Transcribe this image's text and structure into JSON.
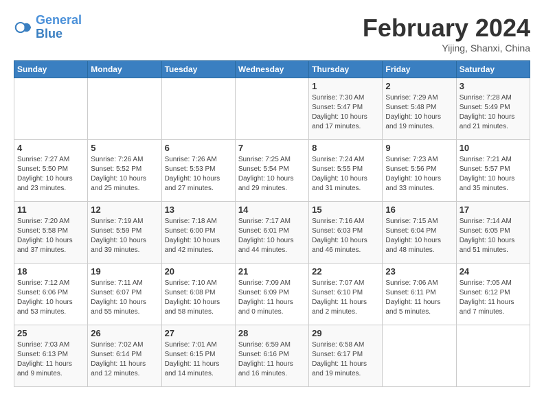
{
  "header": {
    "logo_line1": "General",
    "logo_line2": "Blue",
    "month_title": "February 2024",
    "location": "Yijing, Shanxi, China"
  },
  "weekdays": [
    "Sunday",
    "Monday",
    "Tuesday",
    "Wednesday",
    "Thursday",
    "Friday",
    "Saturday"
  ],
  "weeks": [
    [
      {
        "day": "",
        "info": ""
      },
      {
        "day": "",
        "info": ""
      },
      {
        "day": "",
        "info": ""
      },
      {
        "day": "",
        "info": ""
      },
      {
        "day": "1",
        "info": "Sunrise: 7:30 AM\nSunset: 5:47 PM\nDaylight: 10 hours\nand 17 minutes."
      },
      {
        "day": "2",
        "info": "Sunrise: 7:29 AM\nSunset: 5:48 PM\nDaylight: 10 hours\nand 19 minutes."
      },
      {
        "day": "3",
        "info": "Sunrise: 7:28 AM\nSunset: 5:49 PM\nDaylight: 10 hours\nand 21 minutes."
      }
    ],
    [
      {
        "day": "4",
        "info": "Sunrise: 7:27 AM\nSunset: 5:50 PM\nDaylight: 10 hours\nand 23 minutes."
      },
      {
        "day": "5",
        "info": "Sunrise: 7:26 AM\nSunset: 5:52 PM\nDaylight: 10 hours\nand 25 minutes."
      },
      {
        "day": "6",
        "info": "Sunrise: 7:26 AM\nSunset: 5:53 PM\nDaylight: 10 hours\nand 27 minutes."
      },
      {
        "day": "7",
        "info": "Sunrise: 7:25 AM\nSunset: 5:54 PM\nDaylight: 10 hours\nand 29 minutes."
      },
      {
        "day": "8",
        "info": "Sunrise: 7:24 AM\nSunset: 5:55 PM\nDaylight: 10 hours\nand 31 minutes."
      },
      {
        "day": "9",
        "info": "Sunrise: 7:23 AM\nSunset: 5:56 PM\nDaylight: 10 hours\nand 33 minutes."
      },
      {
        "day": "10",
        "info": "Sunrise: 7:21 AM\nSunset: 5:57 PM\nDaylight: 10 hours\nand 35 minutes."
      }
    ],
    [
      {
        "day": "11",
        "info": "Sunrise: 7:20 AM\nSunset: 5:58 PM\nDaylight: 10 hours\nand 37 minutes."
      },
      {
        "day": "12",
        "info": "Sunrise: 7:19 AM\nSunset: 5:59 PM\nDaylight: 10 hours\nand 39 minutes."
      },
      {
        "day": "13",
        "info": "Sunrise: 7:18 AM\nSunset: 6:00 PM\nDaylight: 10 hours\nand 42 minutes."
      },
      {
        "day": "14",
        "info": "Sunrise: 7:17 AM\nSunset: 6:01 PM\nDaylight: 10 hours\nand 44 minutes."
      },
      {
        "day": "15",
        "info": "Sunrise: 7:16 AM\nSunset: 6:03 PM\nDaylight: 10 hours\nand 46 minutes."
      },
      {
        "day": "16",
        "info": "Sunrise: 7:15 AM\nSunset: 6:04 PM\nDaylight: 10 hours\nand 48 minutes."
      },
      {
        "day": "17",
        "info": "Sunrise: 7:14 AM\nSunset: 6:05 PM\nDaylight: 10 hours\nand 51 minutes."
      }
    ],
    [
      {
        "day": "18",
        "info": "Sunrise: 7:12 AM\nSunset: 6:06 PM\nDaylight: 10 hours\nand 53 minutes."
      },
      {
        "day": "19",
        "info": "Sunrise: 7:11 AM\nSunset: 6:07 PM\nDaylight: 10 hours\nand 55 minutes."
      },
      {
        "day": "20",
        "info": "Sunrise: 7:10 AM\nSunset: 6:08 PM\nDaylight: 10 hours\nand 58 minutes."
      },
      {
        "day": "21",
        "info": "Sunrise: 7:09 AM\nSunset: 6:09 PM\nDaylight: 11 hours\nand 0 minutes."
      },
      {
        "day": "22",
        "info": "Sunrise: 7:07 AM\nSunset: 6:10 PM\nDaylight: 11 hours\nand 2 minutes."
      },
      {
        "day": "23",
        "info": "Sunrise: 7:06 AM\nSunset: 6:11 PM\nDaylight: 11 hours\nand 5 minutes."
      },
      {
        "day": "24",
        "info": "Sunrise: 7:05 AM\nSunset: 6:12 PM\nDaylight: 11 hours\nand 7 minutes."
      }
    ],
    [
      {
        "day": "25",
        "info": "Sunrise: 7:03 AM\nSunset: 6:13 PM\nDaylight: 11 hours\nand 9 minutes."
      },
      {
        "day": "26",
        "info": "Sunrise: 7:02 AM\nSunset: 6:14 PM\nDaylight: 11 hours\nand 12 minutes."
      },
      {
        "day": "27",
        "info": "Sunrise: 7:01 AM\nSunset: 6:15 PM\nDaylight: 11 hours\nand 14 minutes."
      },
      {
        "day": "28",
        "info": "Sunrise: 6:59 AM\nSunset: 6:16 PM\nDaylight: 11 hours\nand 16 minutes."
      },
      {
        "day": "29",
        "info": "Sunrise: 6:58 AM\nSunset: 6:17 PM\nDaylight: 11 hours\nand 19 minutes."
      },
      {
        "day": "",
        "info": ""
      },
      {
        "day": "",
        "info": ""
      }
    ]
  ]
}
